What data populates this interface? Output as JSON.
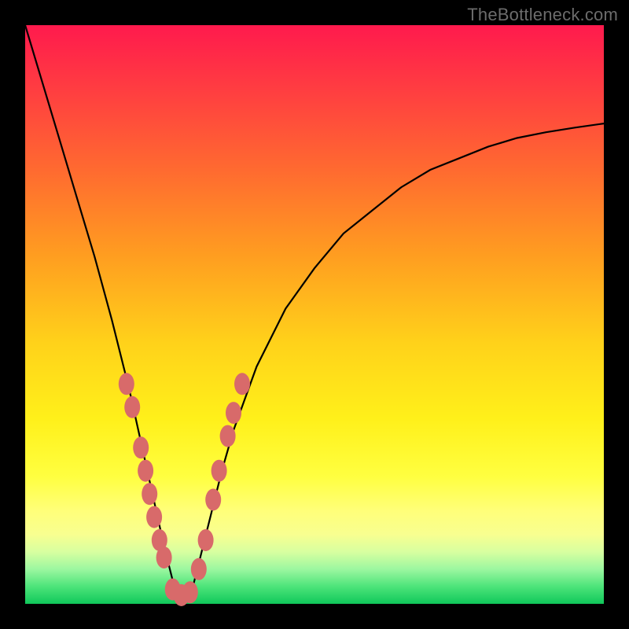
{
  "watermark": "TheBottleneck.com",
  "colors": {
    "background": "#000000",
    "gradient_top": "#ff1a4d",
    "gradient_mid": "#ffd21a",
    "gradient_bottom": "#10c85a",
    "curve_stroke": "#000000",
    "dot_fill": "#d86a6a"
  },
  "chart_data": {
    "type": "line",
    "title": "",
    "xlabel": "",
    "ylabel": "",
    "xlim": [
      0,
      100
    ],
    "ylim": [
      0,
      100
    ],
    "y_axis_inverted": false,
    "description": "V-shaped bottleneck curve. Vertical axis = bottleneck % (0 at bottom, ~100 at top). Horizontal axis = relative component strength. Minimum ~0% near x≈27. Values estimated from pixels.",
    "series": [
      {
        "name": "bottleneck-percent",
        "x": [
          0,
          3,
          6,
          9,
          12,
          15,
          18,
          20,
          22,
          24,
          25,
          26,
          27,
          28,
          29,
          30,
          32,
          34,
          36,
          40,
          45,
          50,
          55,
          60,
          65,
          70,
          75,
          80,
          85,
          90,
          95,
          100
        ],
        "y": [
          100,
          90,
          80,
          70,
          60,
          49,
          37,
          28,
          19,
          10,
          6,
          2,
          0,
          1,
          3,
          7,
          15,
          23,
          30,
          41,
          51,
          58,
          64,
          68,
          72,
          75,
          77,
          79,
          80.5,
          81.5,
          82.3,
          83
        ]
      }
    ],
    "markers": {
      "name": "highlight-points",
      "note": "Salmon oval markers clustered along both arms of the V near the bottom.",
      "points": [
        {
          "x": 17.5,
          "y": 38
        },
        {
          "x": 18.5,
          "y": 34
        },
        {
          "x": 20.0,
          "y": 27
        },
        {
          "x": 20.8,
          "y": 23
        },
        {
          "x": 21.5,
          "y": 19
        },
        {
          "x": 22.3,
          "y": 15
        },
        {
          "x": 23.2,
          "y": 11
        },
        {
          "x": 24.0,
          "y": 8
        },
        {
          "x": 25.5,
          "y": 2.5
        },
        {
          "x": 27.0,
          "y": 1.5
        },
        {
          "x": 28.5,
          "y": 2.0
        },
        {
          "x": 30.0,
          "y": 6
        },
        {
          "x": 31.2,
          "y": 11
        },
        {
          "x": 32.5,
          "y": 18
        },
        {
          "x": 33.5,
          "y": 23
        },
        {
          "x": 35.0,
          "y": 29
        },
        {
          "x": 36.0,
          "y": 33
        },
        {
          "x": 37.5,
          "y": 38
        }
      ]
    }
  }
}
